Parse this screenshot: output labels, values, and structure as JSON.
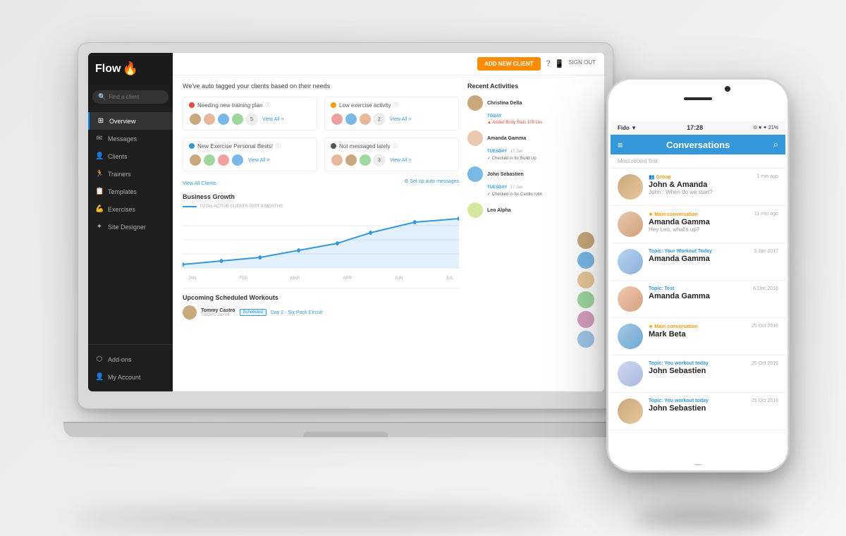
{
  "scene": {
    "background": "#f0f0f0"
  },
  "laptop": {
    "app": {
      "logo": "Flow",
      "logo_icon": "🔥",
      "search_placeholder": "Find a client",
      "add_client_btn": "ADD NEW CLIENT",
      "sign_out": "SIGN OUT",
      "nav": [
        {
          "label": "Overview",
          "icon": "⊞",
          "active": true
        },
        {
          "label": "Messages",
          "icon": "✉"
        },
        {
          "label": "Clients",
          "icon": "👤"
        },
        {
          "label": "Trainers",
          "icon": "🏃"
        },
        {
          "label": "Templates",
          "icon": "📋"
        },
        {
          "label": "Exercises",
          "icon": "💪"
        },
        {
          "label": "Site Designer",
          "icon": "✦"
        }
      ],
      "bottom_nav": [
        {
          "label": "Add-ons",
          "icon": "⬡"
        },
        {
          "label": "My Account",
          "icon": "👤"
        }
      ],
      "auto_tag_title": "We've auto tagged your clients based on their needs",
      "tags": [
        {
          "color": "red",
          "label": "Needing new training plan",
          "count": 5,
          "view_all": "View All >"
        },
        {
          "color": "orange",
          "label": "Low exercise activity",
          "count": 2,
          "view_all": "View All >"
        },
        {
          "color": "blue",
          "label": "New Exercise Personal Bests!",
          "count": null,
          "view_all": "View All >"
        },
        {
          "color": "dark",
          "label": "Not messaged lately",
          "count": 3,
          "view_all": "View All >"
        }
      ],
      "view_all_clients": "View All Clients",
      "setup_auto": "⚙ Set up auto messages",
      "chart_section_title": "Business Growth",
      "chart_label": "TOTAL ACTIVE CLIENTS PAST 6 MONTHS",
      "chart_months": [
        "JAN",
        "FEB",
        "MAR",
        "APR",
        "JUN",
        "JUL"
      ],
      "upcoming_workouts_title": "Upcoming Scheduled Workouts",
      "workout_client": "Tommy Castro",
      "workout_date": "TODAY, Jan 06",
      "workout_status": "Scheduled",
      "workout_name": "Day 2 - Six Pack Circuit",
      "recent_activities_title": "Recent Activities",
      "activities": [
        {
          "name": "Christina Delta",
          "date_label": "TODAY",
          "text": "Added Body Stats 108 Lbs",
          "avatar_class": "av1"
        },
        {
          "name": "Amanda Gamma",
          "date_label": "TUESDAY",
          "date": "17 Jan",
          "text": "Checked in for Build Up",
          "avatar_class": "av2"
        },
        {
          "name": "John Sebastien",
          "date_label": "TUESDAY",
          "date": "17 Jan",
          "text": "Checked in for Cardio rutin",
          "avatar_class": "av3"
        },
        {
          "name": "Leo Alpha",
          "avatar_class": "av4"
        }
      ]
    }
  },
  "phone": {
    "status_carrier": "Fido ▼",
    "status_time": "17:28",
    "status_right": "⊙ ♥ ✦ 21%",
    "nav_title": "Conversations",
    "search_icon": "⌕",
    "menu_icon": "≡",
    "sort_label": "Most recent first",
    "conversations": [
      {
        "tag": "👥 Group",
        "tag_type": "group",
        "name": "John & Amanda",
        "preview": "John : When do we start?",
        "time": "1 min ago",
        "avatar_class": "ca1"
      },
      {
        "tag": "★ Main conversation",
        "tag_type": "main",
        "name": "Amanda Gamma",
        "preview": "Hey Leo, what's up?",
        "time": "11 min ago",
        "avatar_class": "ca2"
      },
      {
        "tag": "Topic: Your Workout Today",
        "tag_type": "topic",
        "name": "Amanda Gamma",
        "preview": "",
        "time": "5 Jan 2017",
        "avatar_class": "ca3"
      },
      {
        "tag": "Topic: Test",
        "tag_type": "topic",
        "name": "Amanda Gamma",
        "preview": "",
        "time": "6 Dec 2016",
        "avatar_class": "ca4"
      },
      {
        "tag": "★ Main conversation",
        "tag_type": "main",
        "name": "Mark Beta",
        "preview": "",
        "time": "25 Oct 2016",
        "avatar_class": "ca5"
      },
      {
        "tag": "Topic: You workout today",
        "tag_type": "topic",
        "name": "John Sebastien",
        "preview": "",
        "time": "25 Oct 2016",
        "avatar_class": "ca6"
      },
      {
        "tag": "Topic: You workout today",
        "tag_type": "topic",
        "name": "John Sebastien",
        "preview": "",
        "time": "25 Oct 2016",
        "avatar_class": "ca1"
      }
    ]
  }
}
